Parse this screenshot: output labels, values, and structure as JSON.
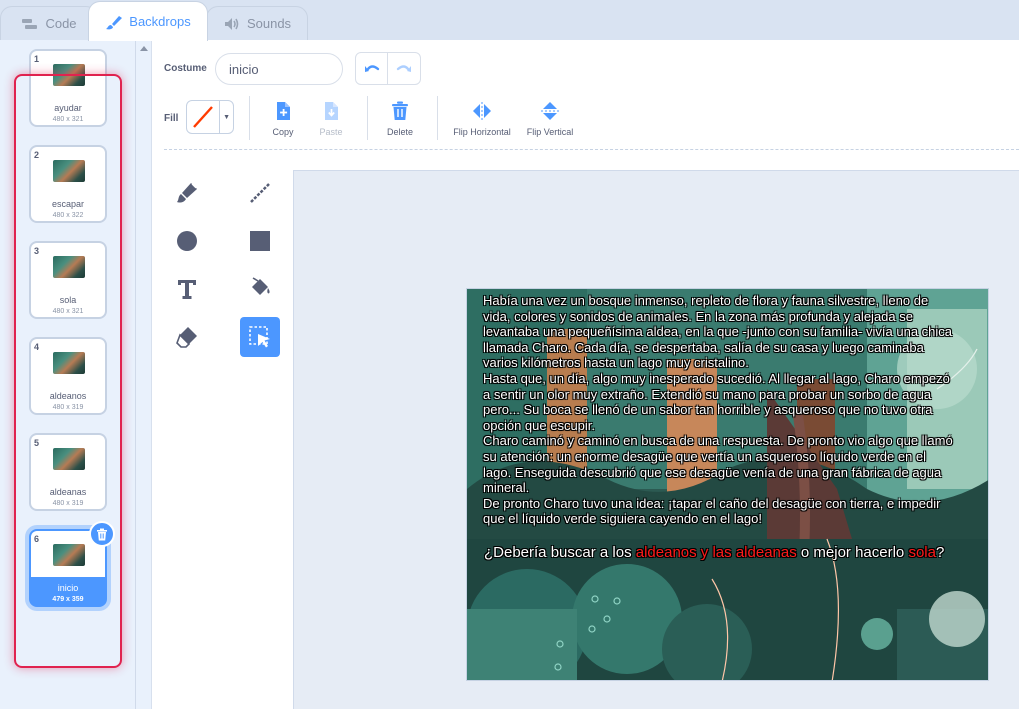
{
  "tabs": [
    {
      "label": "Code",
      "icon": "code-blocks-icon"
    },
    {
      "label": "Backdrops",
      "icon": "paintbrush-icon"
    },
    {
      "label": "Sounds",
      "icon": "speaker-icon"
    }
  ],
  "backdrops": [
    {
      "number": "1",
      "name": "ayudar",
      "size": "480 x 321"
    },
    {
      "number": "2",
      "name": "escapar",
      "size": "480 x 322"
    },
    {
      "number": "3",
      "name": "sola",
      "size": "480 x 321"
    },
    {
      "number": "4",
      "name": "aldeanos",
      "size": "480 x 319"
    },
    {
      "number": "5",
      "name": "aldeanas",
      "size": "480 x 319"
    },
    {
      "number": "6",
      "name": "inicio",
      "size": "479 x 359",
      "selected": true
    }
  ],
  "editor": {
    "costume_label": "Costume",
    "costume_name": "inicio",
    "fill_label": "Fill",
    "fill_color": "#ff3b00",
    "actions": {
      "copy": "Copy",
      "paste": "Paste",
      "delete": "Delete",
      "flip_horizontal": "Flip Horizontal",
      "flip_vertical": "Flip Vertical"
    }
  },
  "tools": [
    "brush-icon",
    "line-icon",
    "circle-icon",
    "rectangle-icon",
    "text-icon",
    "fill-bucket-icon",
    "eraser-icon",
    "select-icon"
  ],
  "canvas": {
    "story_lines": [
      "Había una vez un bosque inmenso, repleto de flora y fauna silvestre, lleno de",
      "vida, colores y sonidos de animales. En la zona más profunda y alejada se",
      "levantaba una pequeñísima aldea, en la que -junto con su familia- vivía una chica",
      "llamada Charo. Cada día,  se despertaba, salía de su casa y luego caminaba",
      "varios kilómetros hasta un lago muy cristalino.",
      "Hasta que, un día, algo muy inesperado sucedió.  Al llegar al lago, Charo empezó",
      "a sentir un olor muy extraño. Extendió su mano para probar un sorbo de agua",
      "pero... Su boca se llenó de un sabor tan horrible y asqueroso que no tuvo otra",
      "opción que escupir.",
      "Charo caminó y caminó en busca de una respuesta. De pronto vio algo que llamó",
      "su atención: un enorme desagüe que vertía un asqueroso líquido verde en el",
      "lago. Enseguida descubrió que ese desagüe venía de una gran fábrica de agua",
      "mineral.",
      "De pronto Charo tuvo una idea: ¡tapar el caño del desagüe con tierra, e impedir",
      "que el líquido verde siguiera cayendo en el lago!"
    ],
    "question": {
      "part1": "¿Debería buscar a los ",
      "aldeanos": "aldeanos",
      "part2": " y las ",
      "aldeanas": "aldeanas",
      "part3": "  o mejor hacerlo ",
      "sola": "sola",
      "part4": "?"
    },
    "highlight_color": "#ff1a1a"
  }
}
